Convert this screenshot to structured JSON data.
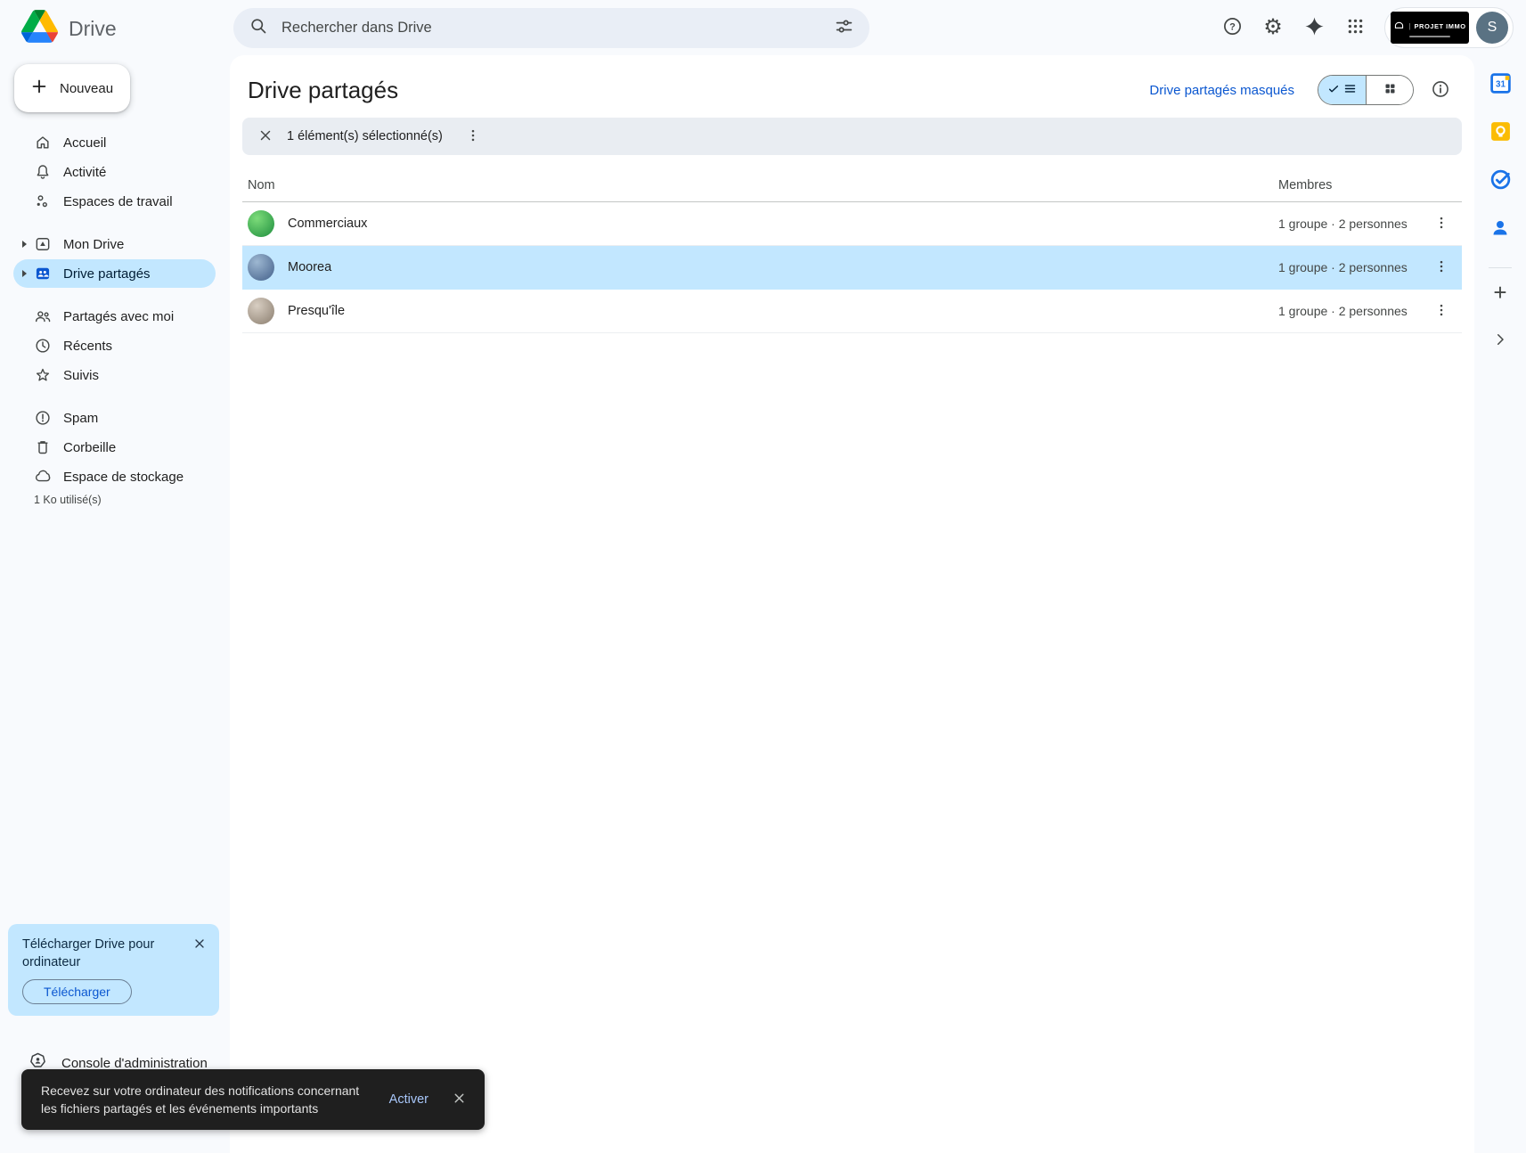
{
  "topbar": {
    "app_name": "Drive",
    "search": {
      "placeholder": "Rechercher dans Drive"
    },
    "account": {
      "org_logo_text": "PROJET IMMO",
      "avatar_initial": "S"
    }
  },
  "sidebar": {
    "new_button": "Nouveau",
    "items": [
      {
        "label": "Accueil"
      },
      {
        "label": "Activité"
      },
      {
        "label": "Espaces de travail"
      },
      {
        "label": "Mon Drive"
      },
      {
        "label": "Drive partagés",
        "selected": true
      },
      {
        "label": "Partagés avec moi"
      },
      {
        "label": "Récents"
      },
      {
        "label": "Suivis"
      },
      {
        "label": "Spam"
      },
      {
        "label": "Corbeille"
      },
      {
        "label": "Espace de stockage"
      }
    ],
    "storage_used": "1 Ko utilisé(s)",
    "admin_console": "Console d'administration"
  },
  "promo": {
    "title": "Télécharger Drive pour ordinateur",
    "button": "Télécharger"
  },
  "toast": {
    "message": "Recevez sur votre ordinateur des notifications concernant les fichiers partagés et les événements importants",
    "action": "Activer"
  },
  "main": {
    "title": "Drive partagés",
    "hidden_link": "Drive partagés masqués",
    "selection_bar": {
      "text": "1 élément(s) sélectionné(s)"
    },
    "table": {
      "columns": {
        "name": "Nom",
        "members": "Membres"
      },
      "rows": [
        {
          "name": "Commerciaux",
          "members": "1 groupe · 2 personnes",
          "selected": false,
          "avatar_colors": [
            "#7ddc7a",
            "#1e8e3e"
          ]
        },
        {
          "name": "Moorea",
          "members": "1 groupe · 2 personnes",
          "selected": true,
          "avatar_colors": [
            "#9db7d1",
            "#43608a"
          ]
        },
        {
          "name": "Presqu'île",
          "members": "1 groupe · 2 personnes",
          "selected": false,
          "avatar_colors": [
            "#d8cec2",
            "#8a7d6e"
          ]
        }
      ]
    }
  },
  "colors": {
    "accent_blue": "#0b57d0",
    "selection_blue": "#c2e7ff",
    "toast_action_blue": "#a8c7fa",
    "toast_bg": "#1f1f1f",
    "background": "#f8fafd"
  },
  "icons": {
    "search": "magnifier",
    "search_filter": "tune-sliders",
    "help": "question-circle",
    "settings": "gear",
    "gemini": "four-point-sparkle",
    "apps": "3x3-dot-grid",
    "plus": "plus",
    "home": "house",
    "activity": "bell",
    "workspaces": "dots-triangle",
    "my_drive": "rounded-square-with-triangle",
    "shared_drives": "rounded-square-with-people",
    "shared_with_me": "two-people",
    "recent": "clock",
    "starred": "star-outline",
    "spam": "exclamation-circle",
    "trash": "bin",
    "storage": "cloud",
    "admin_console": "heptagon-person",
    "close": "x",
    "more": "vertical-kebab-dots",
    "list_view": "check-plus-hamburger",
    "grid_view": "2x2-squares",
    "info": "i-circle",
    "calendar": "blue-31-square",
    "keep": "yellow-bulb-square",
    "tasks": "blue-check-circle",
    "contacts": "blue-person",
    "chevron_right": "chevron"
  }
}
